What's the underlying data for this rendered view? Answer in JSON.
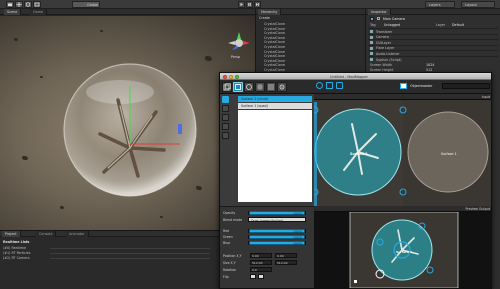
{
  "toolbar": {
    "center_label": "Global",
    "layers_label": "Layers",
    "layout_label": "Layout"
  },
  "scene_tabs": [
    {
      "label": "Scene"
    },
    {
      "label": "Game"
    }
  ],
  "scene": {
    "persp_label": "Persp"
  },
  "hierarchy": {
    "tab_label": "Hierarchy",
    "create_label": "Create",
    "items": [
      "CrystalClone",
      "CrystalClone",
      "CrystalClone",
      "CrystalClone",
      "CrystalClone",
      "CrystalClone",
      "CrystalClone",
      "CrystalClone",
      "CrystalClone",
      "CrystalClone",
      "CrystalClone"
    ]
  },
  "inspector": {
    "tab_label": "Inspector",
    "object_name": "Main Camera",
    "tag_label": "Tag",
    "tag_value": "Untagged",
    "layer_label": "Layer",
    "layer_value": "Default",
    "components": [
      "Transform",
      "Camera",
      "GUILayer",
      "Flare Layer",
      "Audio Listener",
      "Syphon (Script)"
    ],
    "screen_width_label": "Screen Width",
    "screen_width_value": "1024",
    "screen_height_label": "Screen Height",
    "screen_height_value": "512"
  },
  "bottom": {
    "tabs": [
      "Project",
      "Console",
      "Animator"
    ],
    "panel_title": "Realtime Lists",
    "rows": [
      "(#0) Realtime",
      "(#1) RT Particles",
      "(#2) RT Camera"
    ]
  },
  "madmapper": {
    "title": "Untitled - MadMapper",
    "surfaces": [
      "Surface 1 (circle)",
      "Surface 1 (quad)"
    ],
    "props": {
      "opacity_label": "Opacity",
      "opacity_value": "100%",
      "blend_label": "Blend mode",
      "blend_value": "Over (premultiplied)",
      "red_label": "Red",
      "red_value": "100%",
      "green_label": "Green",
      "green_value": "100%",
      "blue_label": "Blue",
      "blue_value": "100%",
      "position_label": "Position X,Y",
      "position_x": "0.00",
      "position_y": "0.00",
      "size_label": "Size X,Y",
      "size_x": "512.00",
      "size_y": "512.00",
      "rotation_label": "Rotation",
      "rotation_value": "0.0",
      "flip_label": "Flip"
    },
    "input_label": "Input",
    "output_label": "Preview Output",
    "surface_caption": "Surface 1",
    "projection_label": "Objectmaster"
  },
  "colors": {
    "accent": "#27a9e1",
    "selection": "#1f88b9"
  },
  "opacity_fill": 1.0,
  "red_fill": 1.0,
  "green_fill": 1.0,
  "blue_fill": 1.0
}
